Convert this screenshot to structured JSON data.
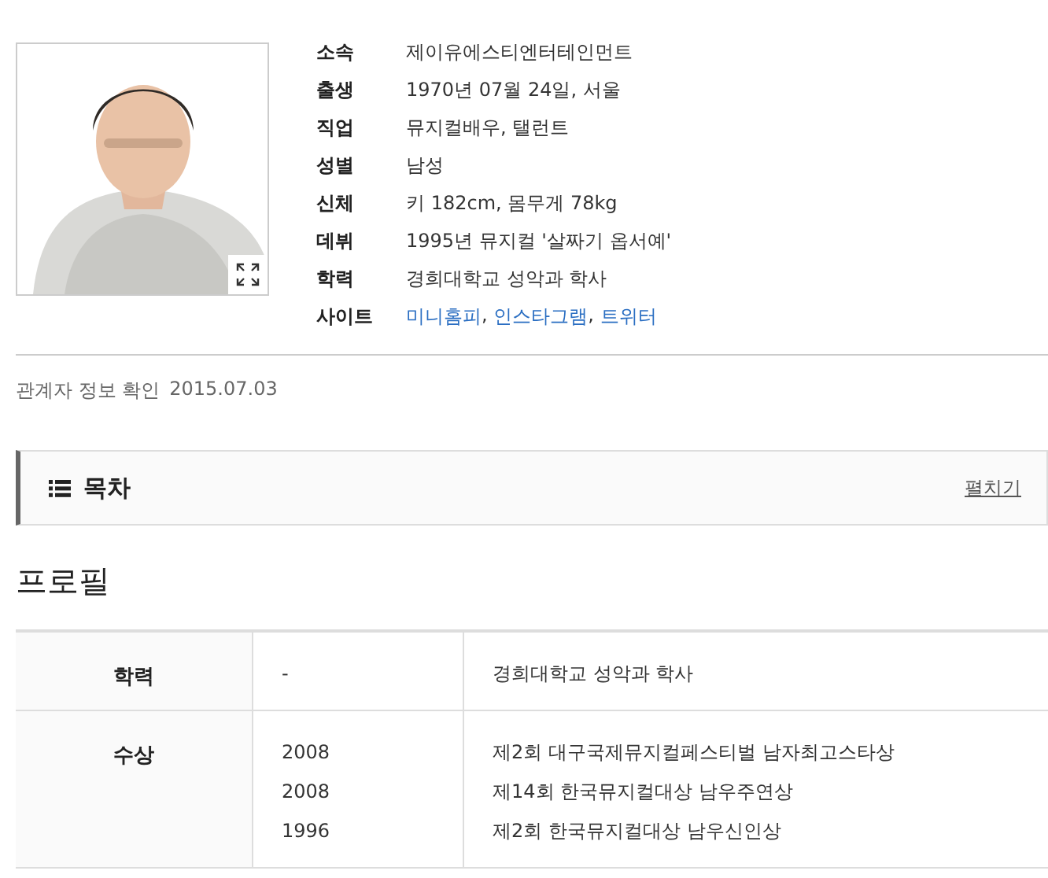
{
  "info": [
    {
      "label": "소속",
      "value": "제이유에스티엔터테인먼트"
    },
    {
      "label": "출생",
      "value": "1970년 07월 24일, 서울"
    },
    {
      "label": "직업",
      "value": "뮤지컬배우, 탤런트"
    },
    {
      "label": "성별",
      "value": "남성"
    },
    {
      "label": "신체",
      "value": "키 182cm, 몸무게 78kg"
    },
    {
      "label": "데뷔",
      "value": "1995년 뮤지컬 '살짜기 옵서예'"
    },
    {
      "label": "학력",
      "value": "경희대학교 성악과 학사"
    }
  ],
  "sites": {
    "label": "사이트",
    "links": [
      "미니홈피",
      "인스타그램",
      "트위터"
    ],
    "separator": ", "
  },
  "verified": {
    "label": "관계자 정보 확인",
    "date": "2015.07.03"
  },
  "toc": {
    "title": "목차",
    "toggle": "펼치기"
  },
  "section_title": "프로필",
  "profile_table": [
    {
      "header": "학력",
      "entries": [
        {
          "year": "-",
          "text": "경희대학교 성악과 학사"
        }
      ]
    },
    {
      "header": "수상",
      "entries": [
        {
          "year": "2008",
          "text": "제2회 대구국제뮤지컬페스티벌 남자최고스타상"
        },
        {
          "year": "2008",
          "text": "제14회 한국뮤지컬대상 남우주연상"
        },
        {
          "year": "1996",
          "text": "제2회 한국뮤지컬대상 남우신인상"
        }
      ]
    }
  ]
}
